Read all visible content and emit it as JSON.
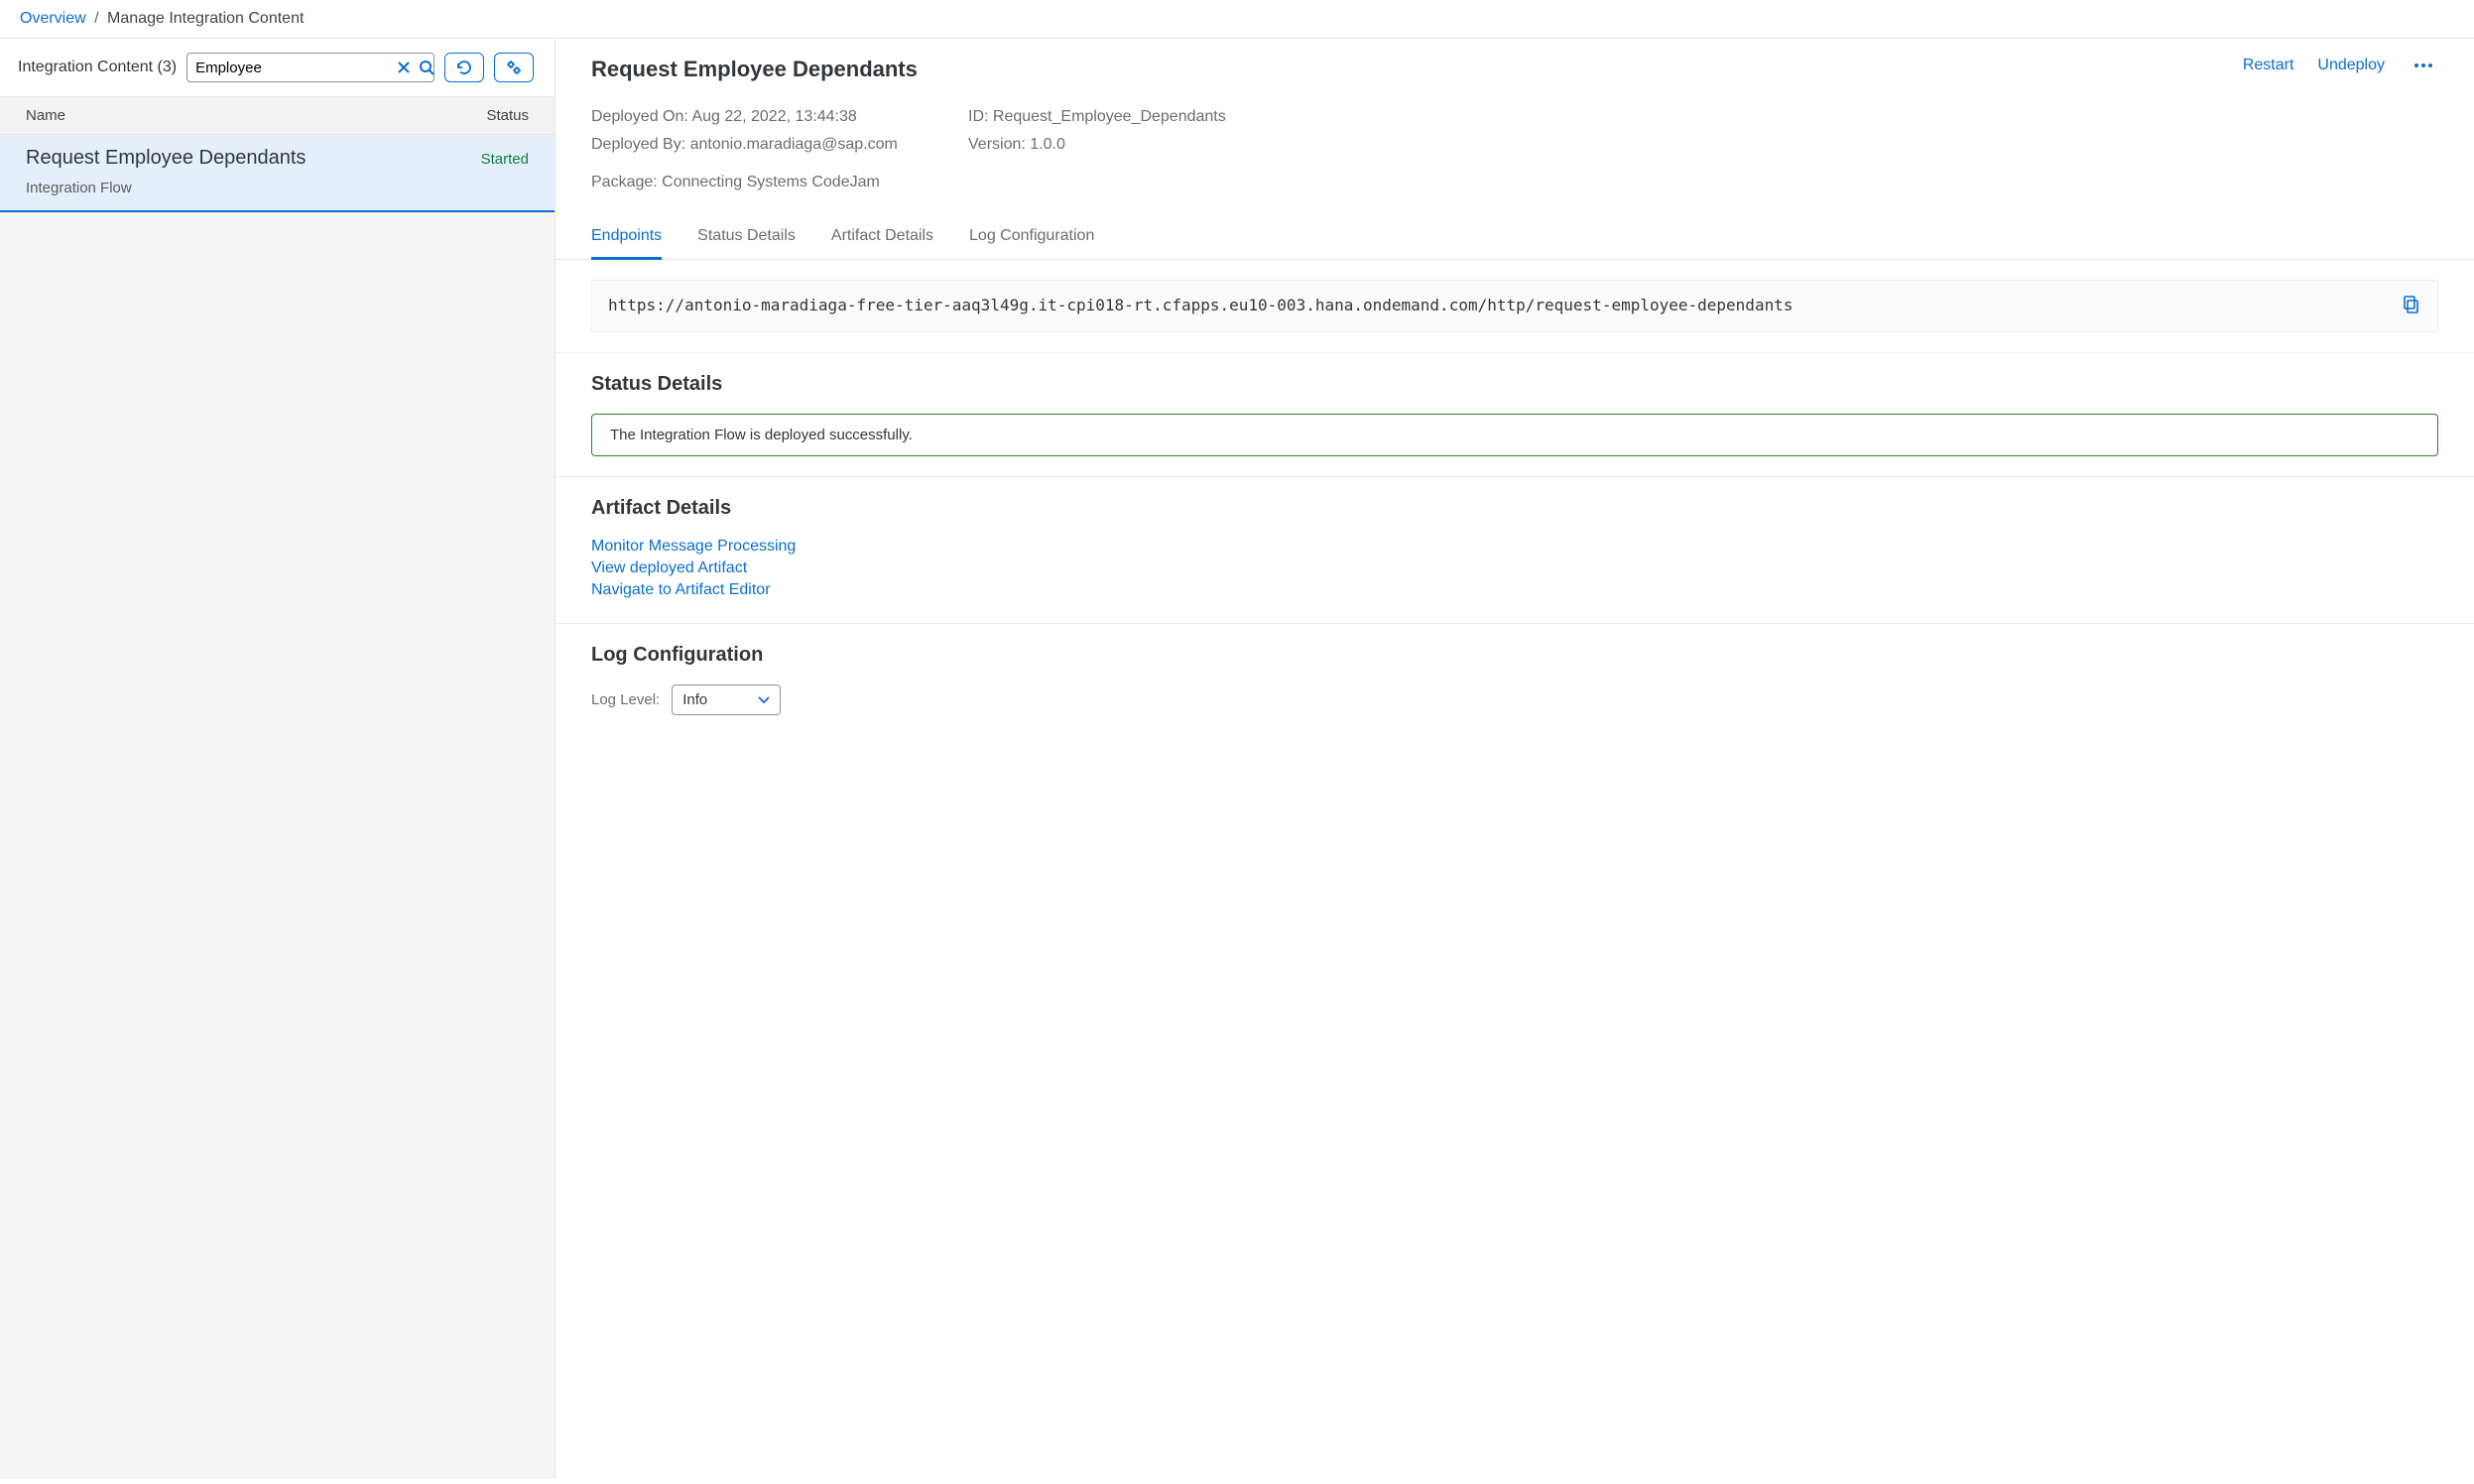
{
  "breadcrumb": {
    "root": "Overview",
    "current": "Manage Integration Content"
  },
  "left": {
    "title": "Integration Content (3)",
    "search_value": "Employee",
    "columns": {
      "name": "Name",
      "status": "Status"
    },
    "row": {
      "title": "Request Employee Dependants",
      "subtitle": "Integration Flow",
      "status": "Started"
    }
  },
  "detail": {
    "title": "Request Employee Dependants",
    "actions": {
      "restart": "Restart",
      "undeploy": "Undeploy"
    },
    "meta": {
      "deployed_on_label": "Deployed On:",
      "deployed_on_value": "Aug 22, 2022, 13:44:38",
      "deployed_by_label": "Deployed By:",
      "deployed_by_value": "antonio.maradiaga@sap.com",
      "id_label": "ID:",
      "id_value": "Request_Employee_Dependants",
      "version_label": "Version:",
      "version_value": "1.0.0",
      "package_label": "Package:",
      "package_value": "Connecting Systems CodeJam"
    },
    "tabs": {
      "endpoints": "Endpoints",
      "status_details": "Status Details",
      "artifact_details": "Artifact Details",
      "log_config": "Log Configuration"
    },
    "endpoint_url": "https://antonio-maradiaga-free-tier-aaq3l49g.it-cpi018-rt.cfapps.eu10-003.hana.ondemand.com/http/request-employee-dependants",
    "status_section": {
      "title": "Status Details",
      "message": "The Integration Flow is deployed successfully."
    },
    "artifact_section": {
      "title": "Artifact Details",
      "links": {
        "monitor": "Monitor Message Processing",
        "view": "View deployed Artifact",
        "navigate": "Navigate to Artifact Editor"
      }
    },
    "log_section": {
      "title": "Log Configuration",
      "label": "Log Level:",
      "value": "Info"
    }
  }
}
